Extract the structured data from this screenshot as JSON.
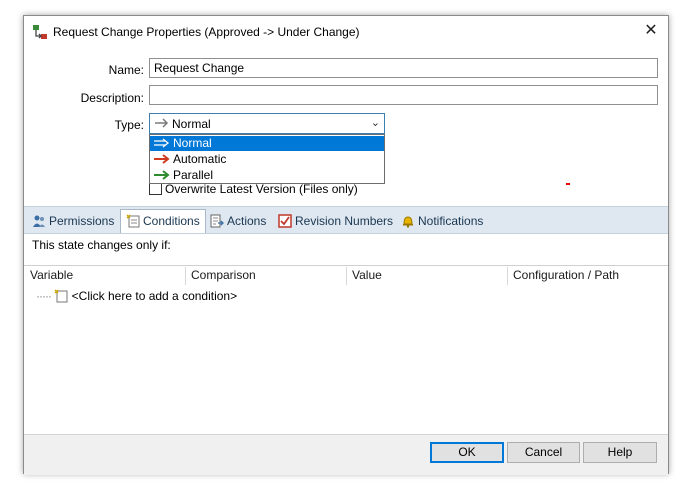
{
  "window": {
    "title": "Request Change Properties (Approved -> Under Change)",
    "close_glyph": "✕"
  },
  "form": {
    "name_label": "Name:",
    "name_value": "Request Change",
    "description_label": "Description:",
    "description_value": "",
    "type_label": "Type:",
    "type_value": "Normal",
    "type_options": [
      {
        "label": "Normal",
        "icon": "arrow-normal-icon",
        "color": "#7a7a7a"
      },
      {
        "label": "Automatic",
        "icon": "arrow-automatic-icon",
        "color": "#d03a1e"
      },
      {
        "label": "Parallel",
        "icon": "arrow-parallel-icon",
        "color": "#2e8b2e"
      }
    ],
    "overwrite_label": "Overwrite Latest Version (Files only)"
  },
  "tabs": [
    {
      "label": "Permissions",
      "icon": "people-icon"
    },
    {
      "label": "Conditions",
      "icon": "conditions-icon"
    },
    {
      "label": "Actions",
      "icon": "actions-icon"
    },
    {
      "label": "Revision Numbers",
      "icon": "revision-icon"
    },
    {
      "label": "Notifications",
      "icon": "bell-icon"
    }
  ],
  "conditions": {
    "description": "This state changes only if:",
    "columns": [
      "Variable",
      "Comparison",
      "Value",
      "Configuration / Path"
    ],
    "add_placeholder": "<Click here to add a condition>"
  },
  "buttons": {
    "ok": "OK",
    "cancel": "Cancel",
    "help": "Help"
  },
  "colors": {
    "accent": "#0078d7",
    "tab_bar": "#dfe8f1"
  }
}
